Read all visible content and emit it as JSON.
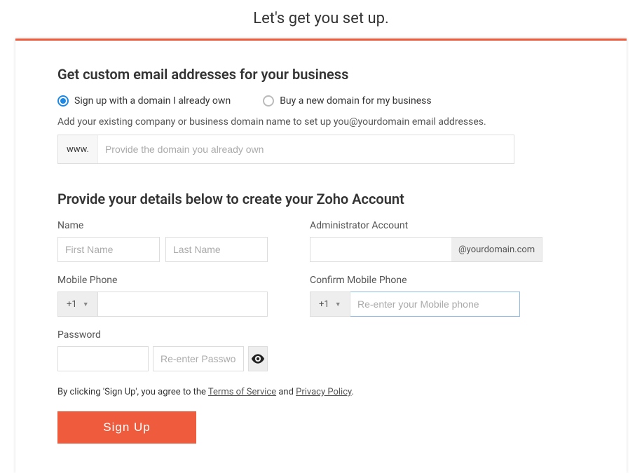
{
  "page_title": "Let's get you set up.",
  "domain_section": {
    "heading": "Get custom email addresses for your business",
    "option_own": "Sign up with a domain I already own",
    "option_buy": "Buy a new domain for my business",
    "helper": "Add your existing company or business domain name to set up you@yourdomain email addresses.",
    "prefix": "www.",
    "placeholder": "Provide the domain you already own"
  },
  "details_section": {
    "heading": "Provide your details below to create your Zoho Account",
    "name_label": "Name",
    "first_name_placeholder": "First Name",
    "last_name_placeholder": "Last Name",
    "admin_label": "Administrator Account",
    "admin_suffix": "@yourdomain.com",
    "mobile_label": "Mobile Phone",
    "country_code": "+1",
    "confirm_mobile_label": "Confirm Mobile Phone",
    "confirm_country_code": "+1",
    "confirm_mobile_placeholder": "Re-enter your Mobile phone",
    "password_label": "Password",
    "reenter_password_placeholder": "Re-enter Password"
  },
  "agree": {
    "prefix": "By clicking 'Sign Up', you agree to the ",
    "tos": "Terms of Service",
    "mid": " and ",
    "privacy": "Privacy Policy",
    "suffix": "."
  },
  "signup_button": "Sign Up"
}
